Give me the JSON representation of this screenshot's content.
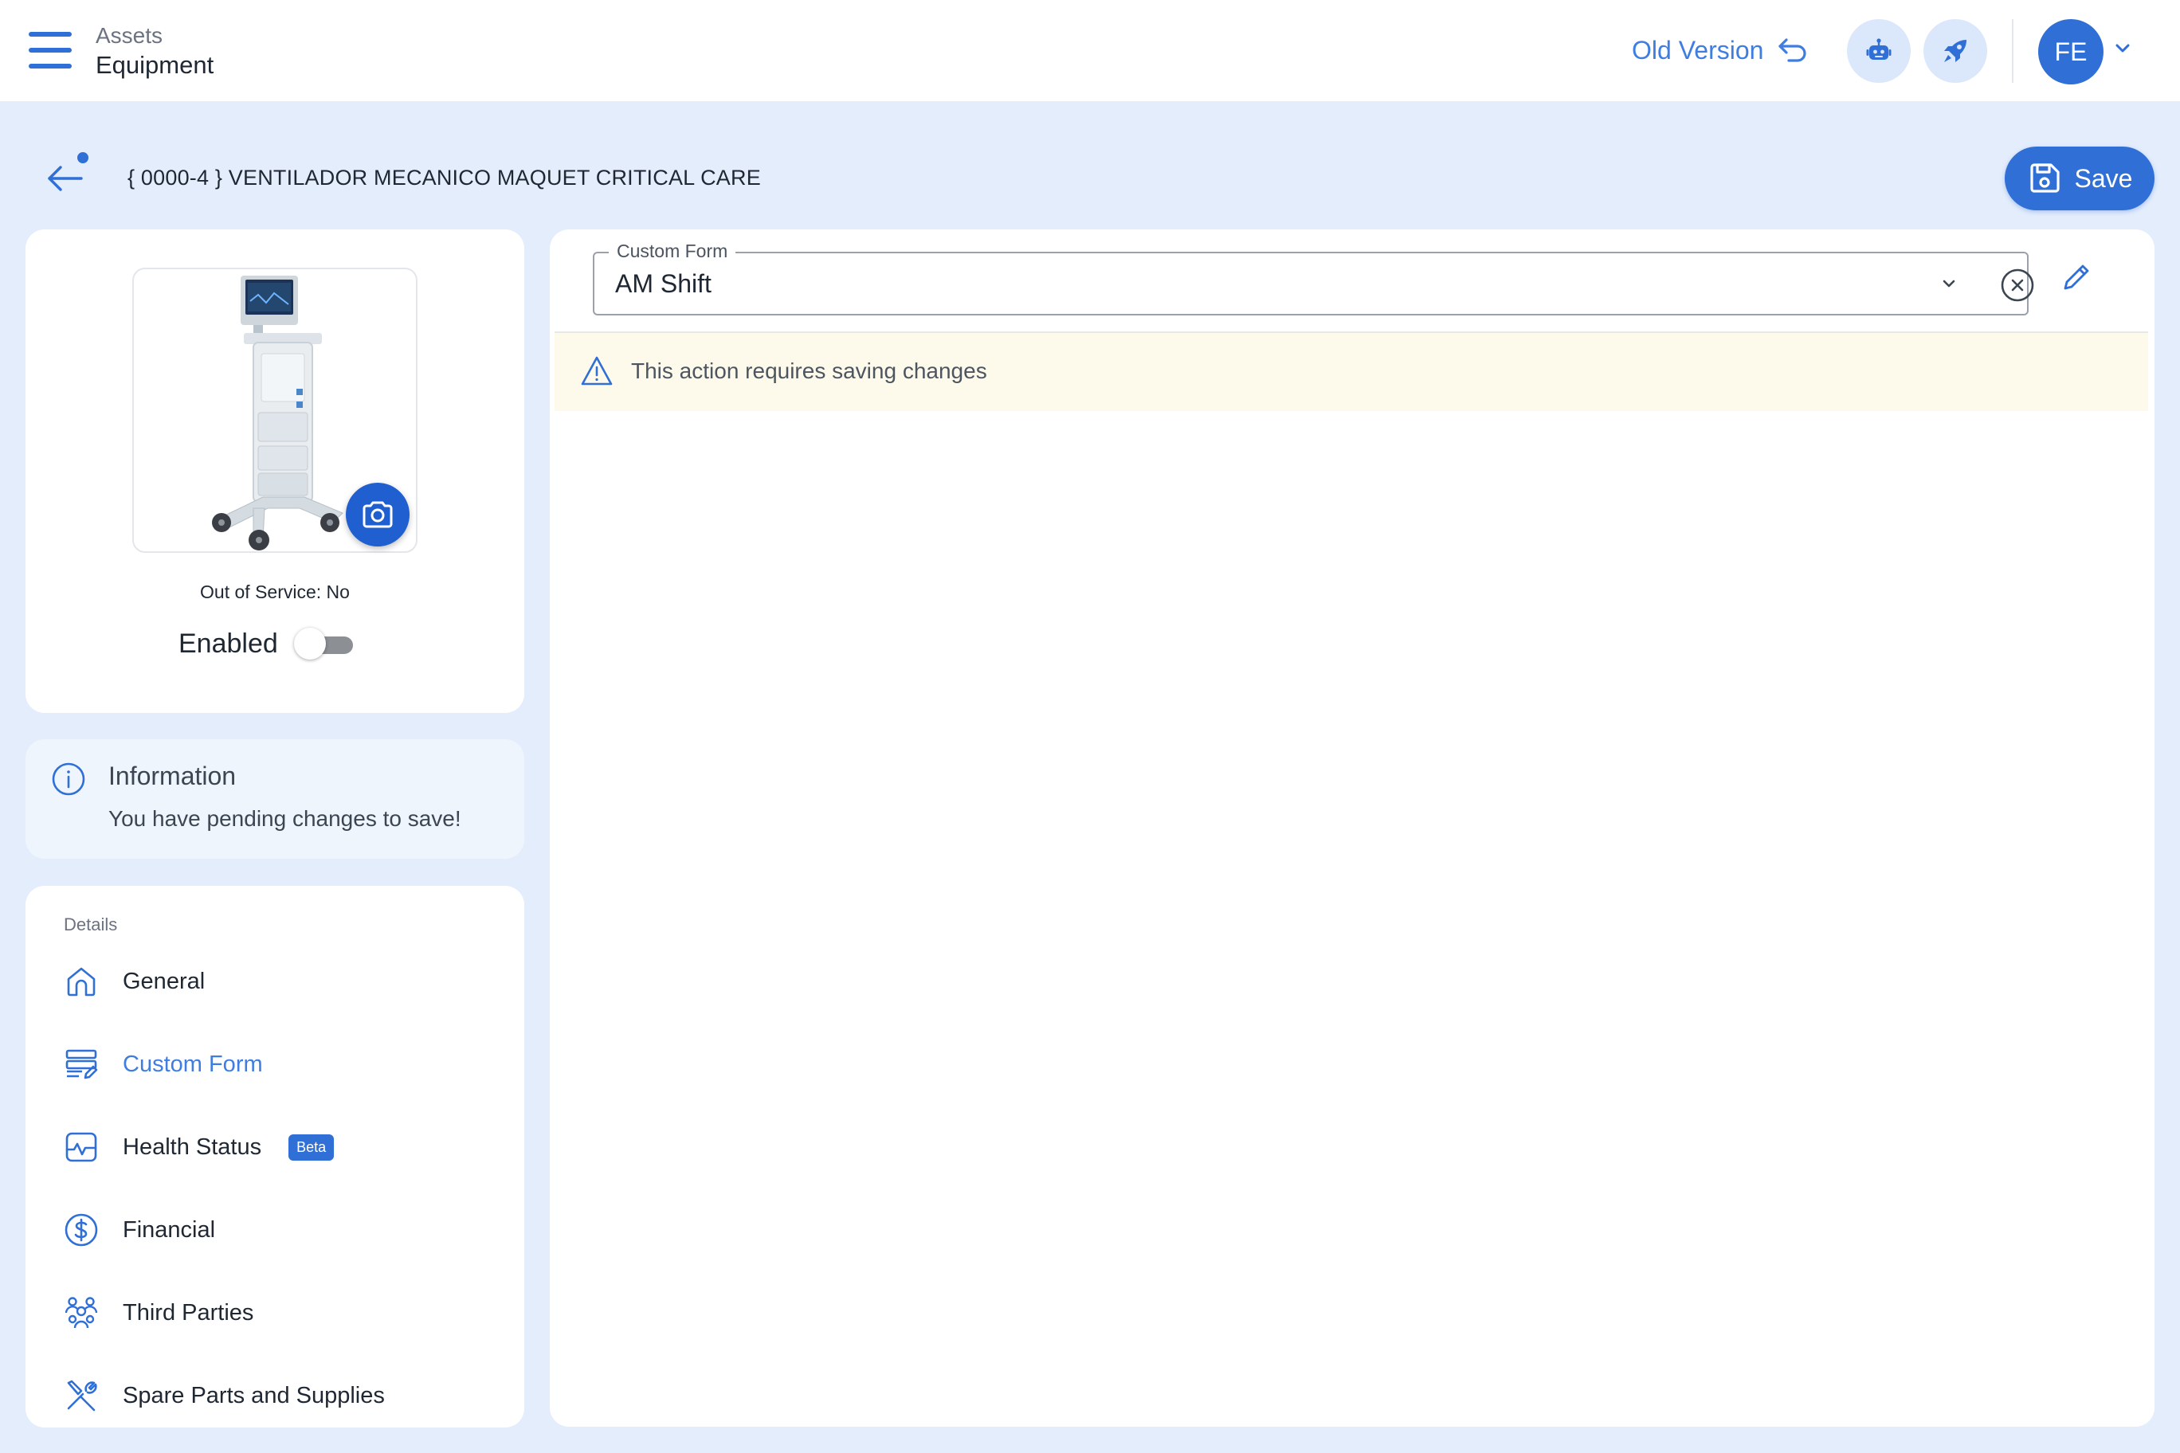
{
  "header": {
    "breadcrumb_parent": "Assets",
    "breadcrumb_current": "Equipment",
    "old_version_label": "Old Version",
    "user_initials": "FE",
    "accent_color": "#2f6fd6"
  },
  "asset": {
    "title": "{ 0000-4 } VENTILADOR MECANICO MAQUET CRITICAL CARE",
    "out_of_service": "Out of Service: No",
    "enabled_label": "Enabled",
    "enabled": false
  },
  "toolbar": {
    "save_label": "Save"
  },
  "info": {
    "title": "Information",
    "message": "You have pending changes to save!"
  },
  "details": {
    "heading": "Details",
    "items": [
      {
        "label": "General",
        "icon": "home-icon"
      },
      {
        "label": "Custom Form",
        "icon": "form-icon",
        "active": true
      },
      {
        "label": "Health Status",
        "icon": "heartbeat-icon",
        "badge": "Beta"
      },
      {
        "label": "Financial",
        "icon": "dollar-icon"
      },
      {
        "label": "Third Parties",
        "icon": "people-group-icon"
      },
      {
        "label": "Spare Parts and Supplies",
        "icon": "tools-icon"
      }
    ]
  },
  "custom_form": {
    "field_label": "Custom Form",
    "selected_value": "AM Shift",
    "warning": "This action requires saving changes"
  }
}
